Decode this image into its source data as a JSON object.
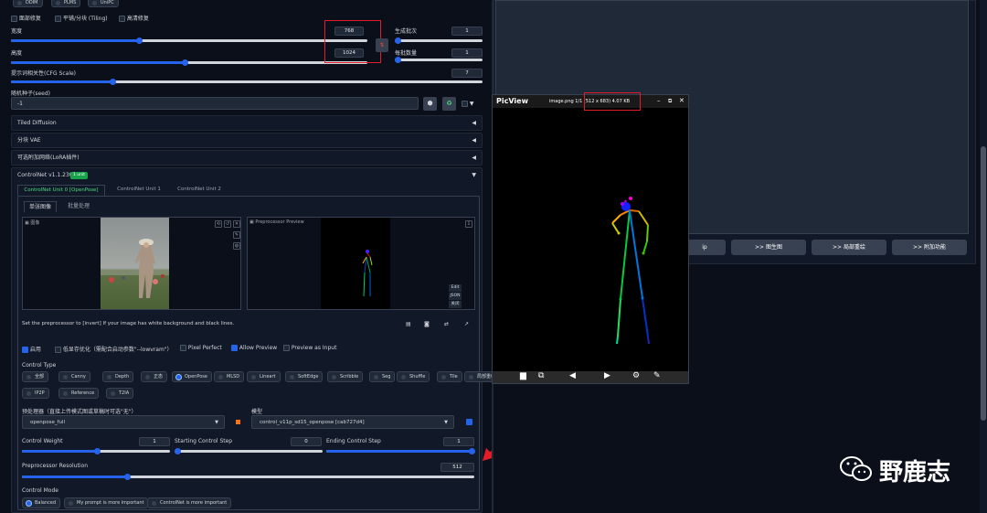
{
  "samplers": [
    "DDIM",
    "PLMS",
    "UniPC"
  ],
  "options": {
    "restore_faces": "面部修复",
    "tiling": "平铺/分块 (Tiling)",
    "hires_fix": "高清修复"
  },
  "width": {
    "label": "宽度",
    "value": "768"
  },
  "height": {
    "label": "高度",
    "value": "1024"
  },
  "batch_count": {
    "label": "生成批次",
    "value": "1"
  },
  "batch_size": {
    "label": "每批数量",
    "value": "1"
  },
  "cfg": {
    "label": "提示词相关性(CFG Scale)",
    "value": "7"
  },
  "seed": {
    "label": "随机种子(seed)",
    "value": "-1"
  },
  "accordions": {
    "tiled": "Tiled Diffusion",
    "vae": "分块 VAE",
    "lora": "可选附加网络(LoRA插件)"
  },
  "controlnet": {
    "title": "ControlNet v1.1.230",
    "badge": "1 unit",
    "units": [
      "ControlNet Unit 0 [OpenPose]",
      "ControlNet Unit 1",
      "ControlNet Unit 2"
    ],
    "subtabs": [
      "单张图像",
      "批量处理"
    ],
    "image_label": "图像",
    "preview_label": "Preprocessor Preview",
    "hint": "Set the preprocessor to [invert] If your image has white background and black lines.",
    "preview_btns": [
      "Edit",
      "JSON",
      "关闭"
    ],
    "enable": "启用",
    "lowvram": "低显存优化（需配合启动参数\"--lowvram\"）",
    "pixel_perfect": "Pixel Perfect",
    "allow_preview": "Allow Preview",
    "preview_input": "Preview as Input",
    "control_type_label": "Control Type",
    "control_types": [
      "全部",
      "Canny",
      "Depth",
      "正态",
      "OpenPose",
      "MLSD",
      "Lineart",
      "SoftEdge",
      "Scribble",
      "Seg",
      "Shuffle",
      "Tile",
      "局部重绘",
      "IP2P",
      "Reference",
      "T2IA"
    ],
    "selected_type": "OpenPose",
    "preprocessor_label": "预处理器（直接上传模式图或草稿时可选\"无\"）",
    "preprocessor": "openpose_full",
    "model_label": "模型",
    "model": "control_v11p_sd15_openpose [cab727d4]",
    "weight": {
      "label": "Control Weight",
      "value": "1"
    },
    "start": {
      "label": "Starting Control Step",
      "value": "0"
    },
    "end": {
      "label": "Ending Control Step",
      "value": "1"
    },
    "resolution": {
      "label": "Preprocessor Resolution",
      "value": "512"
    },
    "mode_label": "Control Mode",
    "modes": [
      "Balanced",
      "My prompt is more important",
      "ControlNet is more important"
    ]
  },
  "right_buttons": [
    "ip",
    ">> 图生图",
    ">> 局部重绘",
    ">> 附加功能"
  ],
  "picview": {
    "title": "PicView",
    "info_prefix": "image.png 1/1 ",
    "info": "(512 x 683) 4.07 KB"
  },
  "watermark": "野鹿志",
  "colors": {
    "accent": "#2563eb",
    "highlight": "#e11d2a",
    "bg": "#0b0f19",
    "badge": "#16a34a"
  }
}
